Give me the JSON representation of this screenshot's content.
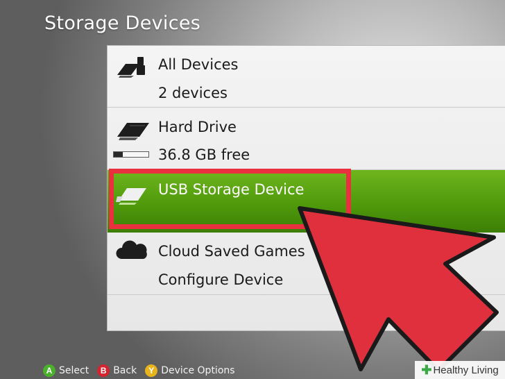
{
  "title": "Storage Devices",
  "items": [
    {
      "label": "All Devices",
      "detail": "2 devices",
      "icon": "devices-icon"
    },
    {
      "label": "Hard Drive",
      "detail": "36.8 GB free",
      "icon": "hard-drive-icon",
      "storage_used_fraction": 0.25
    },
    {
      "label": "USB Storage Device",
      "detail": "",
      "icon": "usb-drive-icon",
      "selected": true
    },
    {
      "label": "Cloud Saved Games",
      "detail": "Configure Device",
      "icon": "cloud-icon"
    }
  ],
  "controls": [
    {
      "key": "A",
      "label": "Select",
      "color": "#4bb02d"
    },
    {
      "key": "B",
      "label": "Back",
      "color": "#d4242f"
    },
    {
      "key": "Y",
      "label": "Device Options",
      "color": "#e8b41c"
    }
  ],
  "colors": {
    "selected_bg": "#5aa512",
    "highlight": "#e8303e",
    "arrow": "#e0303e"
  },
  "watermark": "Healthy Living"
}
